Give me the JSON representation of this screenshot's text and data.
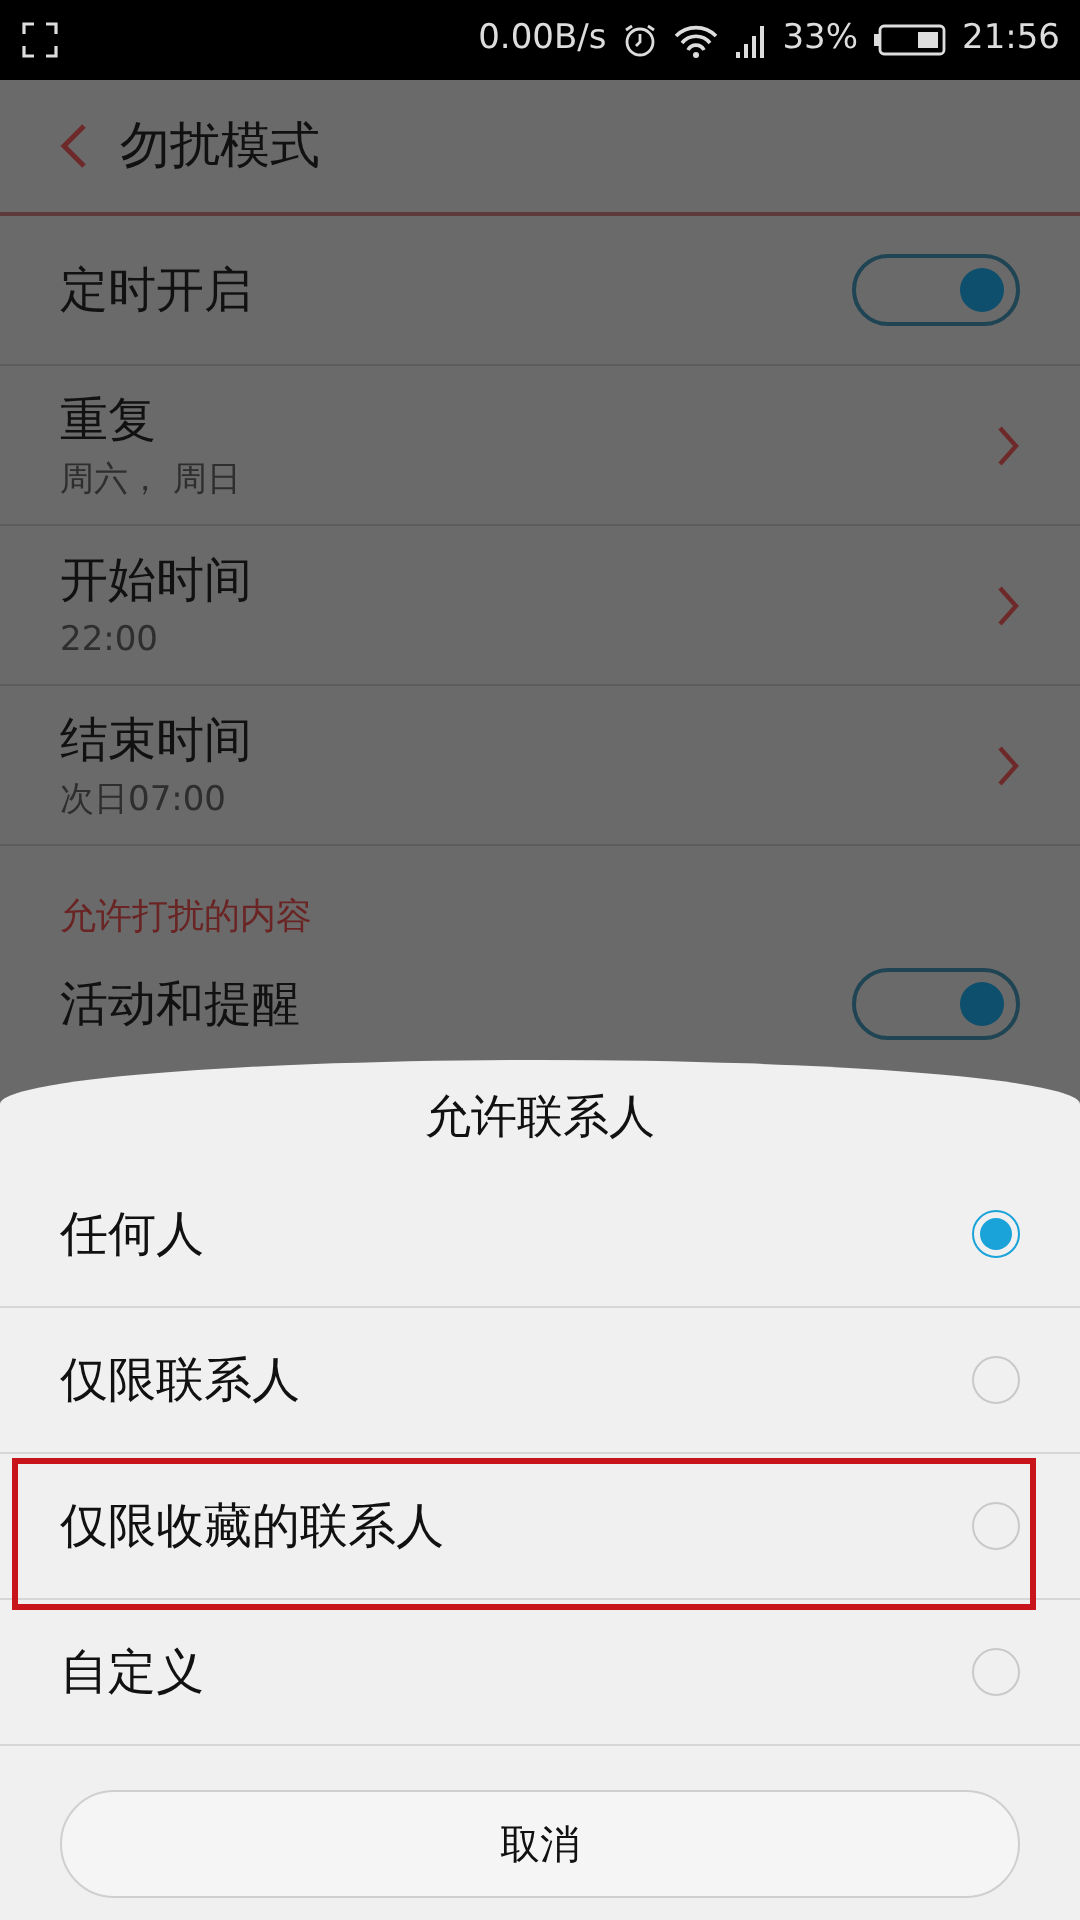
{
  "status_bar": {
    "network_speed": "0.00B/s",
    "battery": "33%",
    "time": "21:56"
  },
  "header": {
    "title": "勿扰模式"
  },
  "settings": [
    {
      "kind": "toggle",
      "label": "定时开启",
      "on": true
    },
    {
      "kind": "link",
      "label": "重复",
      "value": "周六， 周日"
    },
    {
      "kind": "link",
      "label": "开始时间",
      "value": "22:00"
    },
    {
      "kind": "link",
      "label": "结束时间",
      "value": "次日07:00"
    },
    {
      "kind": "section",
      "label": "允许打扰的内容"
    },
    {
      "kind": "toggle",
      "label": "活动和提醒",
      "on": true
    }
  ],
  "sheet": {
    "title": "允许联系人",
    "options": [
      {
        "label": "任何人",
        "selected": true,
        "highlighted": false
      },
      {
        "label": "仅限联系人",
        "selected": false,
        "highlighted": false
      },
      {
        "label": "仅限收藏的联系人",
        "selected": false,
        "highlighted": true
      },
      {
        "label": "自定义",
        "selected": false,
        "highlighted": false
      }
    ],
    "cancel": "取消"
  }
}
